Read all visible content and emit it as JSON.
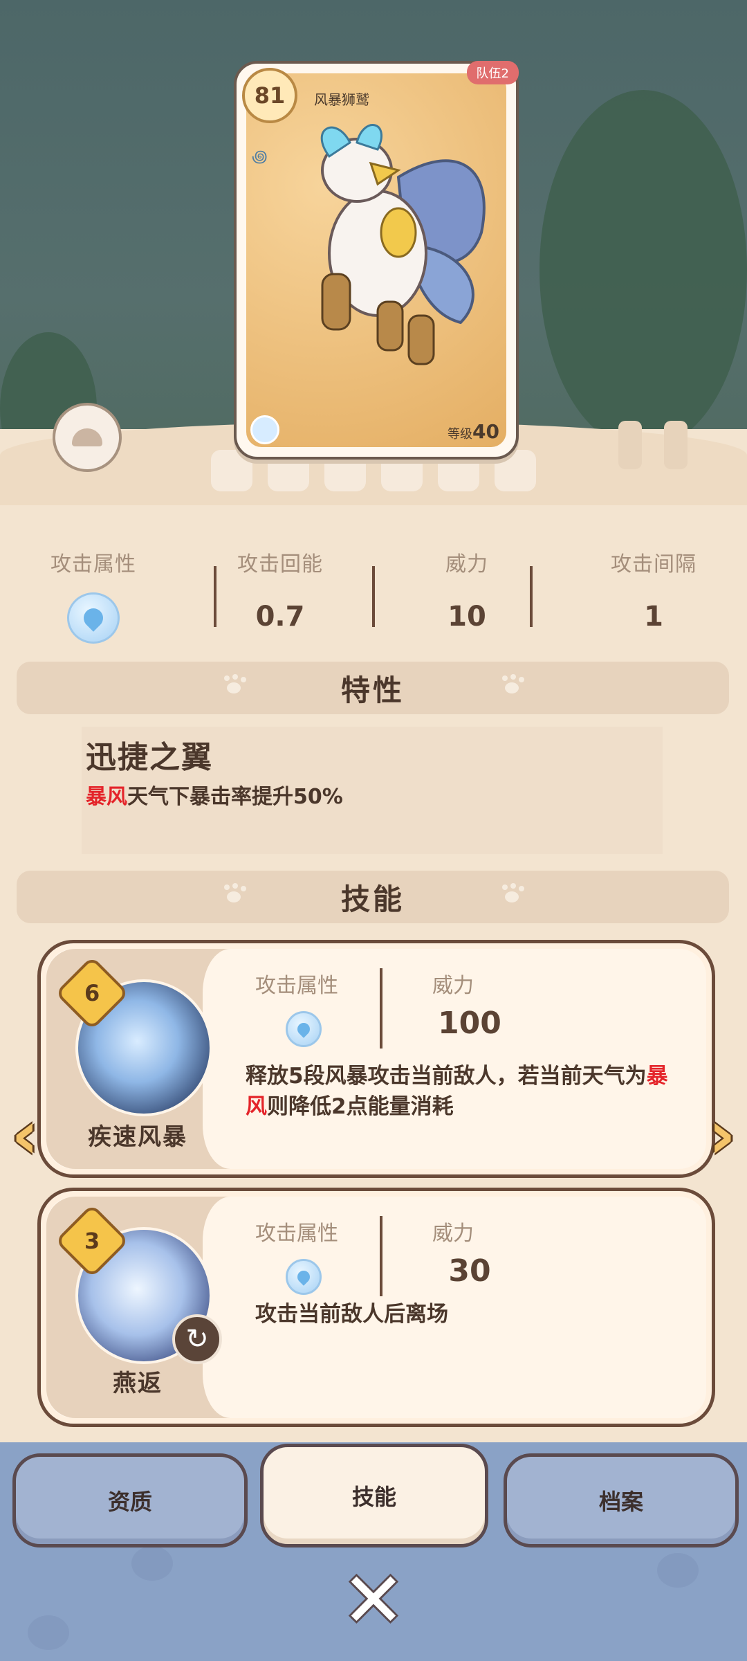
{
  "card": {
    "level": "81",
    "name": "风暴狮鹫",
    "team": "队伍2",
    "level_label": "等级",
    "level_value": "40"
  },
  "stats": [
    {
      "label": "攻击属性",
      "icon": "wind-feather-icon"
    },
    {
      "label": "攻击回能",
      "value": "0.7"
    },
    {
      "label": "威力",
      "value": "10"
    },
    {
      "label": "攻击间隔",
      "value": "1"
    }
  ],
  "trait_section": {
    "title": "特性",
    "name": "迅捷之翼",
    "desc_highlight": "暴风",
    "desc_rest": "天气下暴击率提升50%"
  },
  "skill_section": {
    "title": "技能",
    "skills": [
      {
        "cost": "6",
        "name": "疾速风暴",
        "attr_label": "攻击属性",
        "power_label": "威力",
        "power": "100",
        "desc_part1": "释放5段风暴攻击当前敌人，若当前天气为",
        "desc_highlight": "暴风",
        "desc_part2": "则降低2点能量消耗"
      },
      {
        "cost": "3",
        "name": "燕返",
        "attr_label": "攻击属性",
        "power_label": "威力",
        "power": "30",
        "desc": "攻击当前敌人后离场"
      }
    ]
  },
  "tabs": [
    {
      "label": "资质",
      "active": false
    },
    {
      "label": "技能",
      "active": true
    },
    {
      "label": "档案",
      "active": false
    }
  ],
  "colors": {
    "highlight_red": "#e4242a",
    "bottom_bg": "#8aa2c6",
    "panel_bg": "#f3e4d0"
  }
}
